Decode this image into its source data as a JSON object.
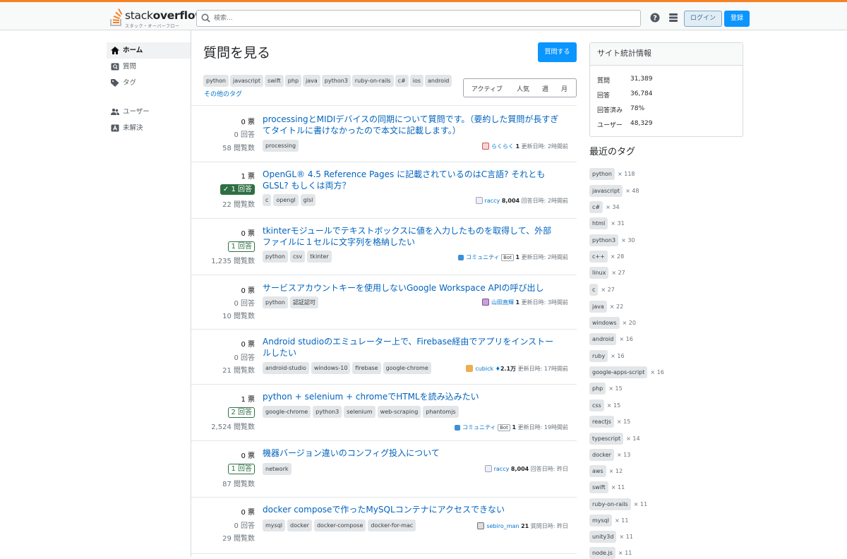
{
  "header": {
    "logo_word_light": "stack",
    "logo_word_bold": "overflow",
    "logo_sub": "スタック・オーバーフロー",
    "search_placeholder": "検索...",
    "help_icon": "help-icon",
    "menu_icon": "site-switcher-icon",
    "login_label": "ログイン",
    "signup_label": "登録"
  },
  "leftnav": {
    "items": [
      {
        "label": "ホーム",
        "icon": "home-icon"
      },
      {
        "label": "質問",
        "icon": "question-icon"
      },
      {
        "label": "タグ",
        "icon": "tag-icon"
      },
      {
        "label": "ユーザー",
        "icon": "users-icon"
      },
      {
        "label": "未解決",
        "icon": "unanswered-icon"
      }
    ]
  },
  "main": {
    "title": "質問を見る",
    "ask_button": "質問する",
    "top_tags": [
      "python",
      "javascript",
      "swift",
      "php",
      "java",
      "python3",
      "ruby-on-rails",
      "c#",
      "ios",
      "android"
    ],
    "more_tags": "その他のタグ",
    "filters": [
      "アクティブ",
      "人気",
      "週",
      "月"
    ]
  },
  "questions": [
    {
      "votes": "0 票",
      "answers": "0 回答",
      "views": "58 閲覧数",
      "title": "processingとMIDIデバイスの同期について質問です。（要約した質問が長すぎてタイトルに書けなかったので本文に記載します。）",
      "tags": [
        "processing"
      ],
      "user": "らくらく",
      "rep": "1",
      "action": "更新日時: 2時間前"
    },
    {
      "votes": "1 票",
      "answers": "✓ 1 回答",
      "views": "22 閲覧数",
      "title": "OpenGL® 4.5 Reference Pages に記載されているのはC言語? それともGLSL? もしくは両方？",
      "tags": [
        "c",
        "opengl",
        "glsl"
      ],
      "user": "raccy",
      "rep": "8,004",
      "action": "回答日時: 2時間前"
    },
    {
      "votes": "0 票",
      "answers": "1 回答",
      "views": "1,235 閲覧数",
      "title": "tkinterモジュールでテキストボックスに値を入力したものを取得して、外部ファイルに１セルに文字列を格納したい",
      "tags": [
        "python",
        "csv",
        "tkinter"
      ],
      "user": "コミュニティ",
      "bot": "Bot",
      "rep": "1",
      "action": "更新日時: 2時間前"
    },
    {
      "votes": "0 票",
      "answers": "0 回答",
      "views": "10 閲覧数",
      "title": "サービスアカウントキーを使用しないGoogle Workspace APIの呼び出し",
      "tags": [
        "python",
        "認証認可"
      ],
      "user": "山田直輝",
      "rep": "1",
      "action": "更新日時: 3時間前"
    },
    {
      "votes": "0 票",
      "answers": "0 回答",
      "views": "21 閲覧数",
      "title": "Android studioのエミュレーター上で、Firebase経由でアプリをインストールしたい",
      "tags": [
        "android-studio",
        "windows-10",
        "firebase",
        "google-chrome"
      ],
      "user": "cubick",
      "diamond": "♦",
      "rep": "2.1万",
      "action": "更新日時: 17時間前"
    },
    {
      "votes": "1 票",
      "answers": "2 回答",
      "views": "2,524 閲覧数",
      "title": "python + selenium + chromeでHTMLを読み込みたい",
      "tags": [
        "google-chrome",
        "python3",
        "selenium",
        "web-scraping",
        "phantomjs"
      ],
      "user": "コミュニティ",
      "bot": "Bot",
      "rep": "1",
      "action": "更新日時: 19時間前"
    },
    {
      "votes": "0 票",
      "answers": "1 回答",
      "views": "87 閲覧数",
      "title": "機器バージョン違いのコンフィグ投入について",
      "tags": [
        "network"
      ],
      "user": "raccy",
      "rep": "8,004",
      "action": "回答日時: 昨日"
    },
    {
      "votes": "0 票",
      "answers": "0 回答",
      "views": "29 閲覧数",
      "title": "docker composeで作ったMySQLコンテナにアクセスできない",
      "tags": [
        "mysql",
        "docker",
        "docker-compose",
        "docker-for-mac"
      ],
      "user": "sebiro_man",
      "rep": "21",
      "action": "質問日時: 昨日"
    }
  ],
  "sidebar": {
    "stats_title": "サイト統計情報",
    "stats": [
      {
        "label": "質問",
        "value": "31,389"
      },
      {
        "label": "回答",
        "value": "36,784"
      },
      {
        "label": "回答済み",
        "value": "78%"
      },
      {
        "label": "ユーザー",
        "value": "48,329"
      }
    ],
    "recent_title": "最近のタグ",
    "recent_tags": [
      {
        "name": "python",
        "count": "× 118"
      },
      {
        "name": "javascript",
        "count": "× 48"
      },
      {
        "name": "c#",
        "count": "× 34"
      },
      {
        "name": "html",
        "count": "× 31"
      },
      {
        "name": "python3",
        "count": "× 30"
      },
      {
        "name": "c++",
        "count": "× 28"
      },
      {
        "name": "linux",
        "count": "× 27"
      },
      {
        "name": "c",
        "count": "× 27"
      },
      {
        "name": "java",
        "count": "× 22"
      },
      {
        "name": "windows",
        "count": "× 20"
      },
      {
        "name": "android",
        "count": "× 16"
      },
      {
        "name": "ruby",
        "count": "× 16"
      },
      {
        "name": "google-apps-script",
        "count": "× 16"
      },
      {
        "name": "php",
        "count": "× 15"
      },
      {
        "name": "css",
        "count": "× 15"
      },
      {
        "name": "reactjs",
        "count": "× 15"
      },
      {
        "name": "typescript",
        "count": "× 14"
      },
      {
        "name": "docker",
        "count": "× 13"
      },
      {
        "name": "aws",
        "count": "× 12"
      },
      {
        "name": "swift",
        "count": "× 11"
      },
      {
        "name": "ruby-on-rails",
        "count": "× 11"
      },
      {
        "name": "mysql",
        "count": "× 11"
      },
      {
        "name": "unity3d",
        "count": "× 11"
      },
      {
        "name": "node.js",
        "count": "× 11"
      }
    ]
  },
  "colors": {
    "accent": "#f48225",
    "link": "#0063bf",
    "primary_button": "#0a95ff",
    "answered": "#2f6f44"
  }
}
